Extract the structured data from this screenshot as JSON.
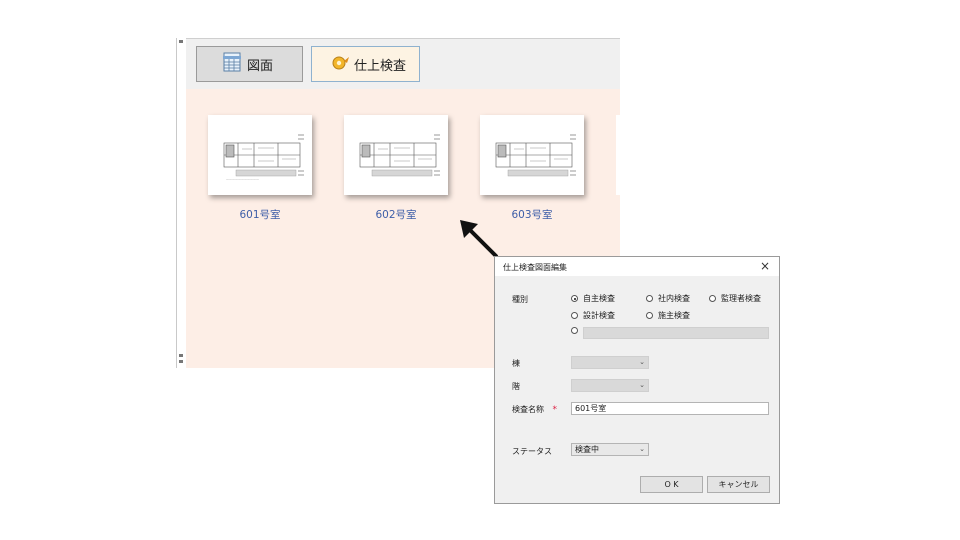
{
  "toolbar": {
    "drawing_label": "図面",
    "finish_inspection_label": "仕上検査"
  },
  "thumbnails": [
    {
      "label": "601号室"
    },
    {
      "label": "602号室"
    },
    {
      "label": "603号室"
    }
  ],
  "dialog": {
    "title": "仕上検査図面編集",
    "close": "×",
    "type_label": "種別",
    "radio_self": "自主検査",
    "radio_company": "社内検査",
    "radio_supervisor": "監理者検査",
    "radio_design": "設計検査",
    "radio_owner": "施主検査",
    "selected_type": "自主検査",
    "building_label": "棟",
    "floor_label": "階",
    "inspection_name_label": "検査名称",
    "required_mark": "*",
    "inspection_name_value": "601号室",
    "status_label": "ステータス",
    "status_value": "検査中",
    "ok_label": "O K",
    "cancel_label": "キャンセル"
  },
  "colors": {
    "content_bg": "#fdeee6",
    "label_blue": "#3e5ea8",
    "active_tab_border": "#8fb2cf"
  }
}
